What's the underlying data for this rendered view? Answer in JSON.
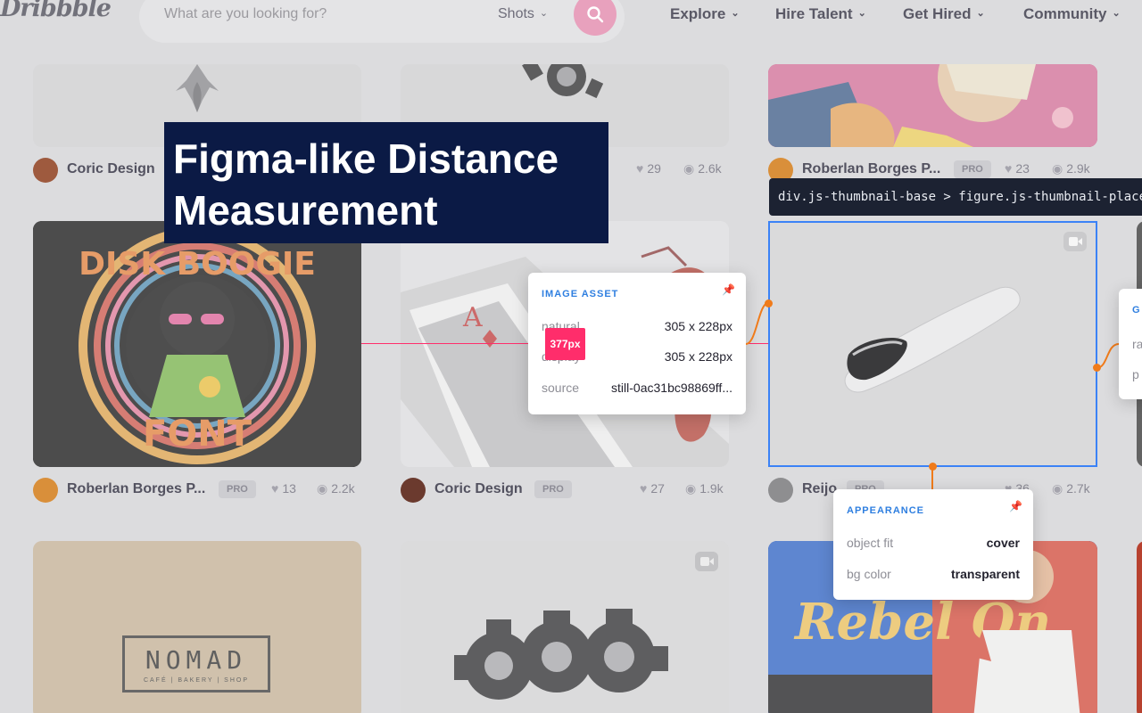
{
  "header": {
    "logo": "Dribbble",
    "search_placeholder": "What are you looking for?",
    "search_scope": "Shots",
    "nav": [
      "Explore",
      "Hire Talent",
      "Get Hired",
      "Community"
    ]
  },
  "shots": {
    "row1": [
      {
        "author": "Coric Design",
        "likes": "29",
        "views": "2.6k",
        "pro": ""
      },
      {
        "author": "Roberlan Borges P...",
        "pro": "PRO",
        "likes": "23",
        "views": "2.9k"
      }
    ],
    "row2": [
      {
        "author": "Roberlan Borges P...",
        "pro": "PRO",
        "likes": "13",
        "views": "2.2k"
      },
      {
        "author": "Coric Design",
        "pro": "PRO",
        "likes": "27",
        "views": "1.9k"
      },
      {
        "author": "Reijo",
        "pro": "PRO",
        "likes": "36",
        "views": "2.7k"
      }
    ],
    "art_text": {
      "disk_top": "DISK BOOGIE",
      "disk_bottom": "FONT",
      "ace": "A",
      "nomad": "NOMAD",
      "nomad_sub": "CAFÉ | BAKERY | SHOP",
      "rebel": "Rebel On"
    }
  },
  "overlay": {
    "title_line1": "Figma-like Distance",
    "title_line2": "Measurement",
    "selector": "div.js-thumbnail-base > figure.js-thumbnail-placeholder",
    "distance_label": "377px",
    "image_asset": {
      "heading": "IMAGE ASSET",
      "rows": [
        {
          "key": "natural",
          "value": "305 x 228px"
        },
        {
          "key": "display",
          "value": "305 x 228px"
        },
        {
          "key": "source",
          "value": "still-0ac31bc98869ff..."
        }
      ]
    },
    "appearance": {
      "heading": "APPEARANCE",
      "rows": [
        {
          "key": "object fit",
          "value": "cover"
        },
        {
          "key": "bg color",
          "value": "transparent"
        }
      ]
    },
    "partial_panel": {
      "heading": "G",
      "row1": "ra",
      "row2": "p"
    }
  },
  "colors": {
    "measure": "#ff2d6b",
    "selection": "#3b82f6",
    "title_bg": "#0b1a45",
    "panel_heading": "#2f7fe0",
    "connector": "#f07b1a"
  }
}
